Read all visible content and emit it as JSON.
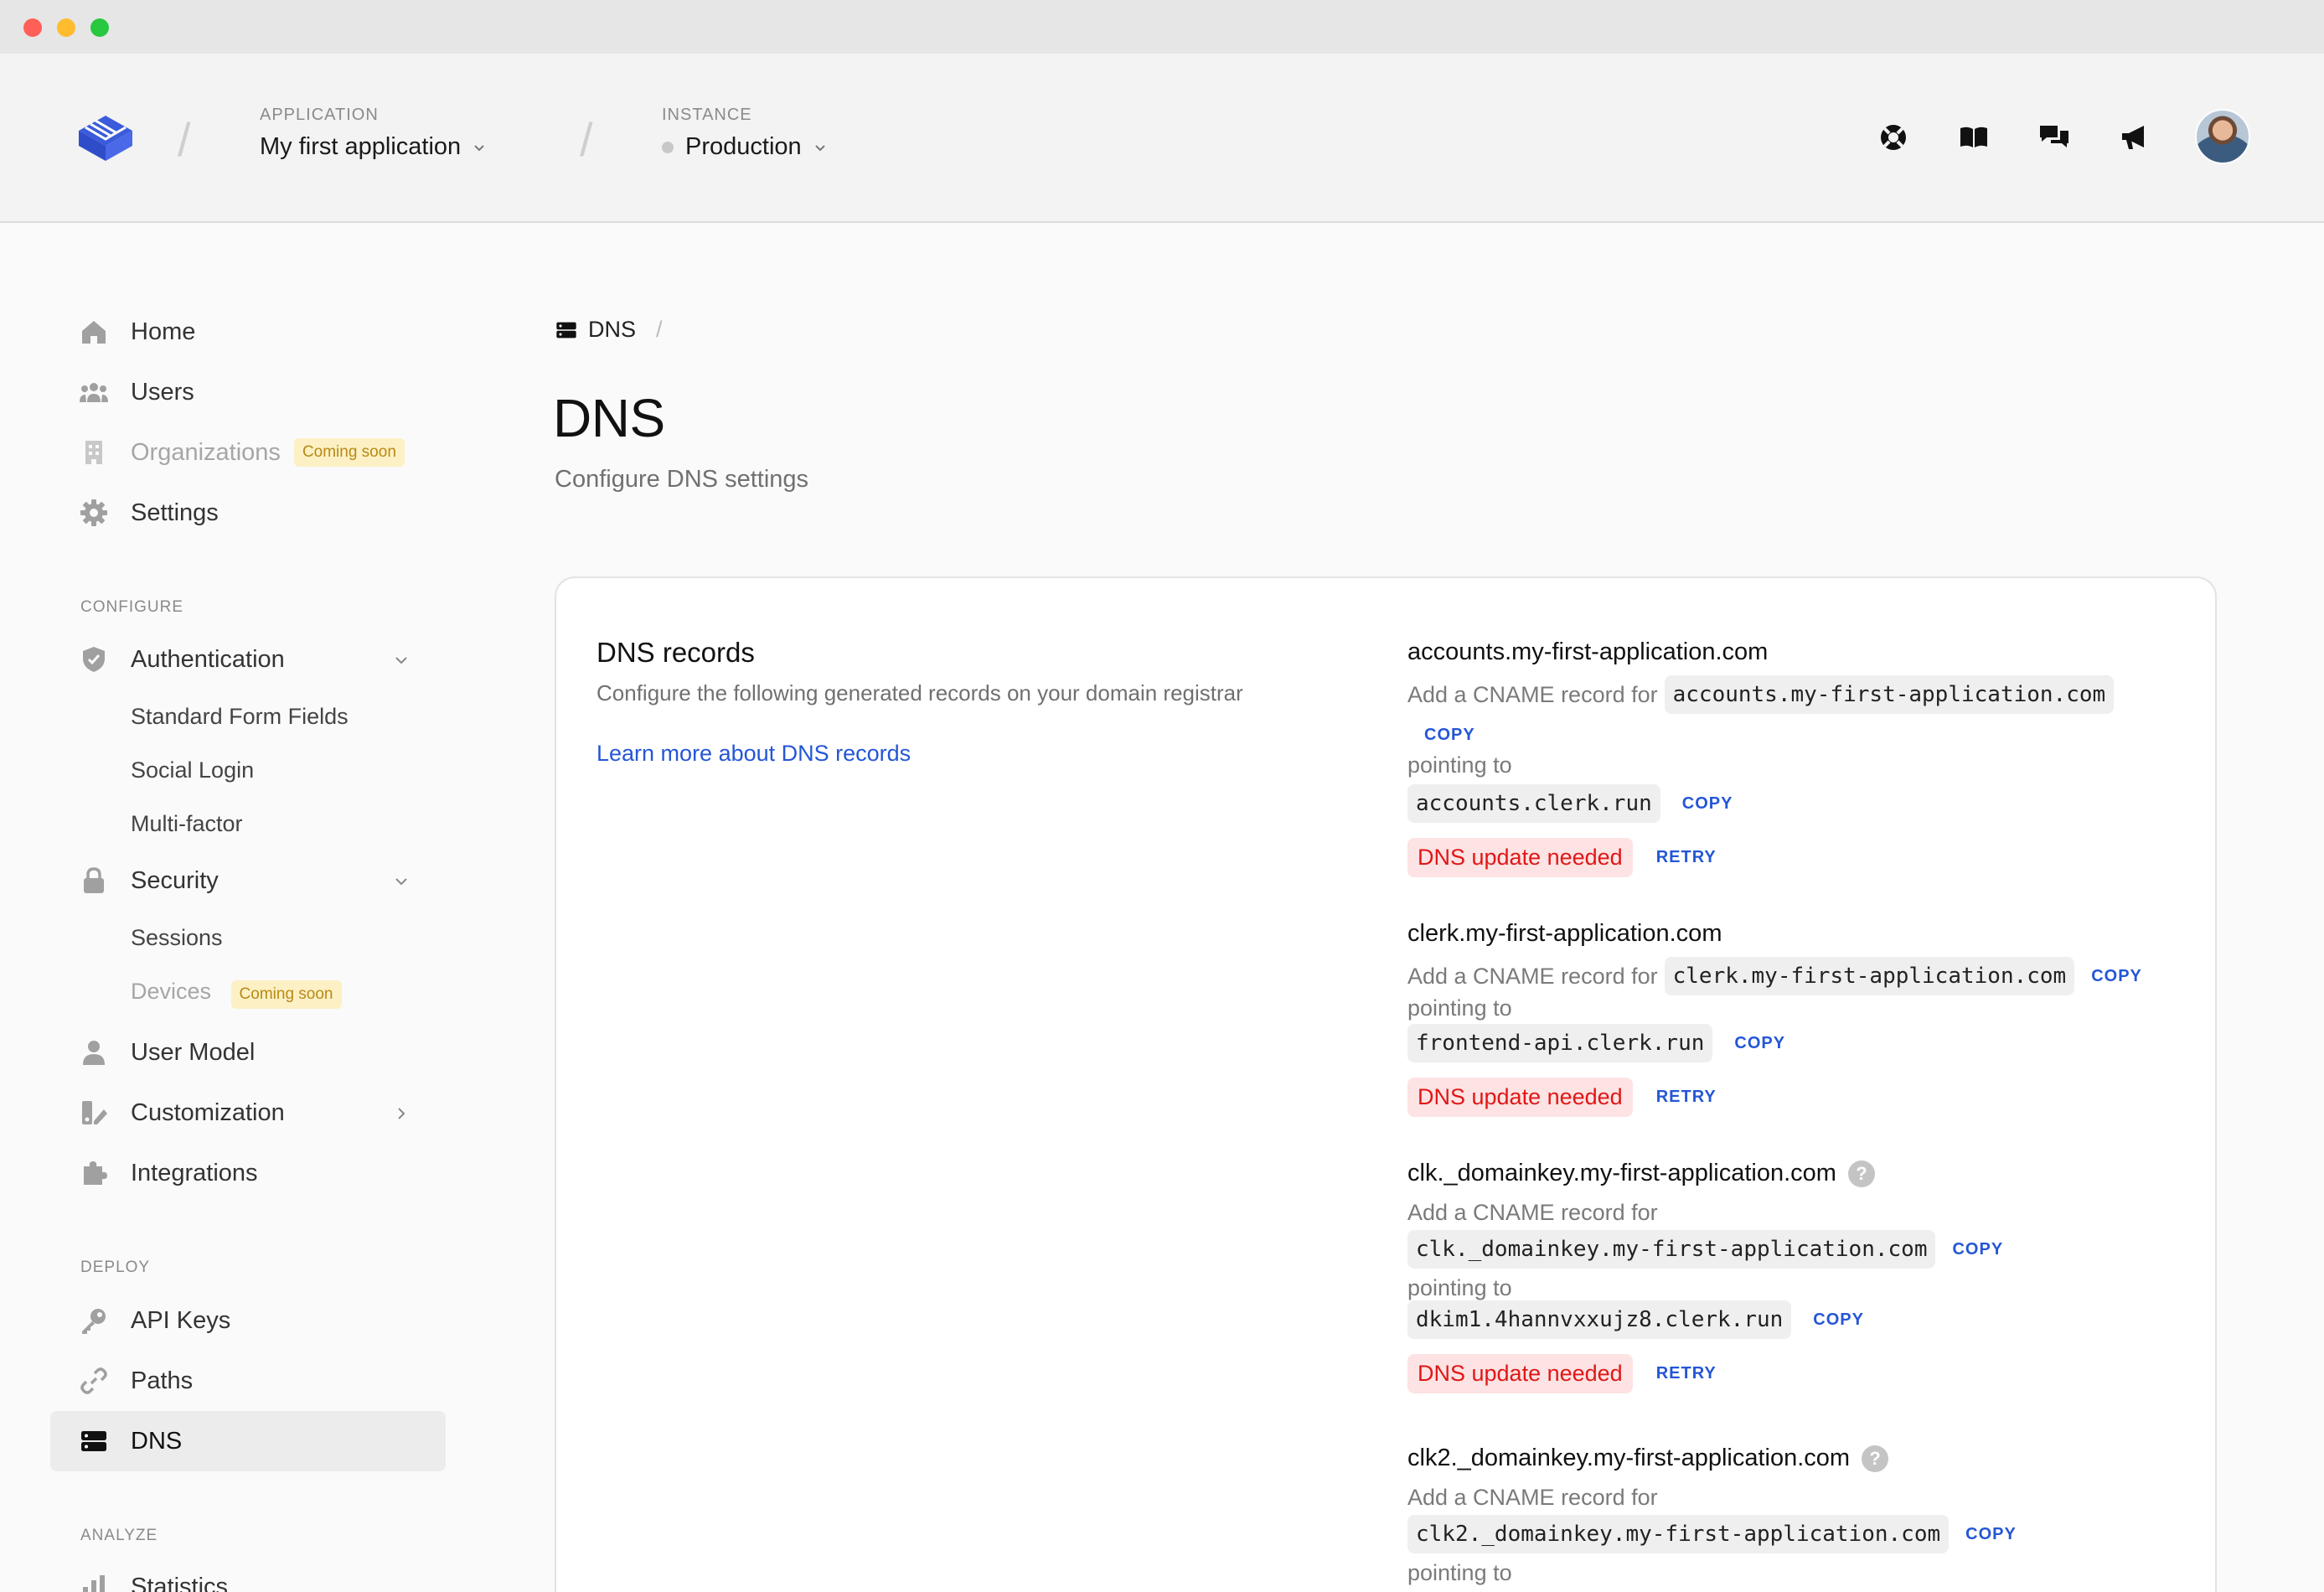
{
  "header": {
    "application": {
      "caption": "APPLICATION",
      "value": "My first application"
    },
    "instance": {
      "caption": "INSTANCE",
      "value": "Production"
    },
    "icons": [
      "support-icon",
      "docs-icon",
      "feedback-icon",
      "announcements-icon"
    ],
    "accent": "#3b5bdb"
  },
  "sidebar": {
    "items": [
      {
        "label": "Home",
        "icon": "home-icon"
      },
      {
        "label": "Users",
        "icon": "users-icon"
      },
      {
        "label": "Organizations",
        "icon": "building-icon",
        "badge": "Coming soon"
      },
      {
        "label": "Settings",
        "icon": "gear-icon"
      }
    ],
    "configure_label": "CONFIGURE",
    "configure": {
      "authentication": "Authentication",
      "auth_sub": [
        "Standard Form Fields",
        "Social Login",
        "Multi-factor"
      ],
      "security": "Security",
      "security_sub": [
        "Sessions",
        "Devices"
      ],
      "devices_badge": "Coming soon",
      "user_model": "User Model",
      "customization": "Customization",
      "integrations": "Integrations"
    },
    "deploy_label": "DEPLOY",
    "deploy": {
      "api_keys": "API Keys",
      "paths": "Paths",
      "dns": "DNS"
    },
    "analyze_label": "ANALYZE",
    "analyze": {
      "statistics": "Statistics"
    }
  },
  "main": {
    "breadcrumb": "DNS",
    "breadcrumb_sep": "/",
    "title": "DNS",
    "subtitle": "Configure DNS settings",
    "card": {
      "title": "DNS records",
      "description": "Configure the following generated records on your domain registrar",
      "link": "Learn more about DNS records",
      "add_prefix": "Add a CNAME record for",
      "pointing": "pointing to",
      "copy": "COPY",
      "retry": "RETRY",
      "status": "DNS update needed",
      "records": [
        {
          "host": "accounts.my-first-application.com",
          "cname": "accounts.my-first-application.com",
          "target": "accounts.clerk.run"
        },
        {
          "host": "clerk.my-first-application.com",
          "cname": "clerk.my-first-application.com",
          "target": "frontend-api.clerk.run"
        },
        {
          "host": "clk._domainkey.my-first-application.com",
          "cname": "clk._domainkey.my-first-application.com",
          "target": "dkim1.4hannvxxujz8.clerk.run"
        },
        {
          "host": "clk2._domainkey.my-first-application.com",
          "cname": "clk2._domainkey.my-first-application.com"
        }
      ]
    }
  }
}
